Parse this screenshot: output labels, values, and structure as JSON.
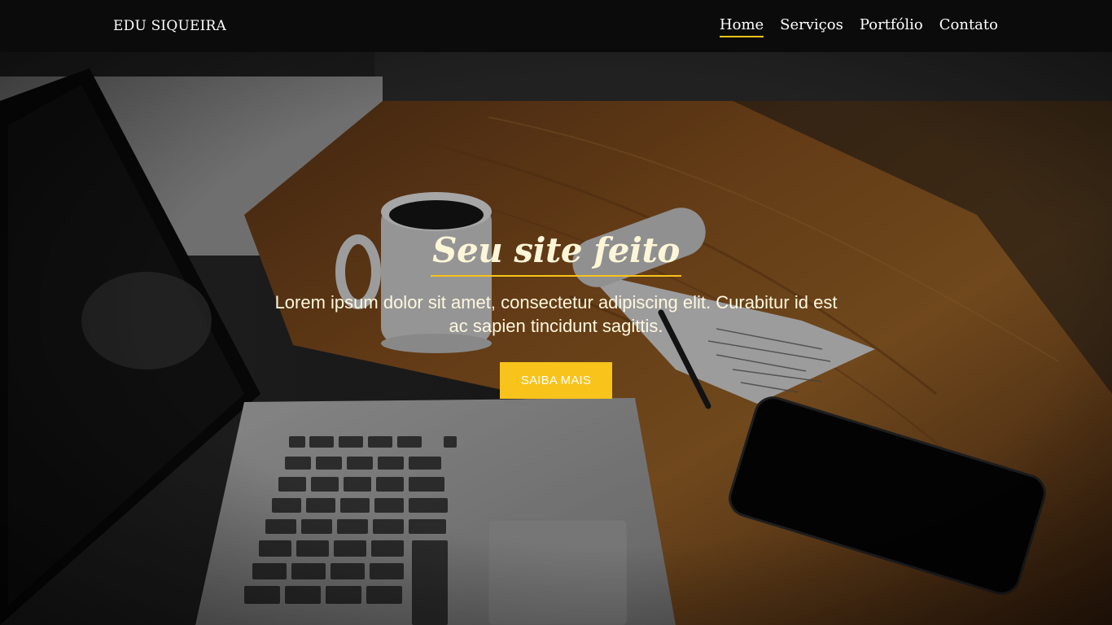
{
  "header": {
    "brand": "EDU SIQUEIRA",
    "nav": [
      {
        "label": "Home",
        "active": true
      },
      {
        "label": "Serviços",
        "active": false
      },
      {
        "label": "Portfólio",
        "active": false
      },
      {
        "label": "Contato",
        "active": false
      }
    ]
  },
  "hero": {
    "title": "Seu site feito",
    "text": "Lorem ipsum dolor sit amet, consectetur adipiscing elit. Curabitur id est ac sapien tincidunt sagittis.",
    "cta_label": "SAIBA MAIS",
    "background_description_icon": "desk-photo"
  },
  "colors": {
    "accent": "#f8c31a",
    "header_bg": "#0b0b0b",
    "text_light": "#fff8df"
  }
}
